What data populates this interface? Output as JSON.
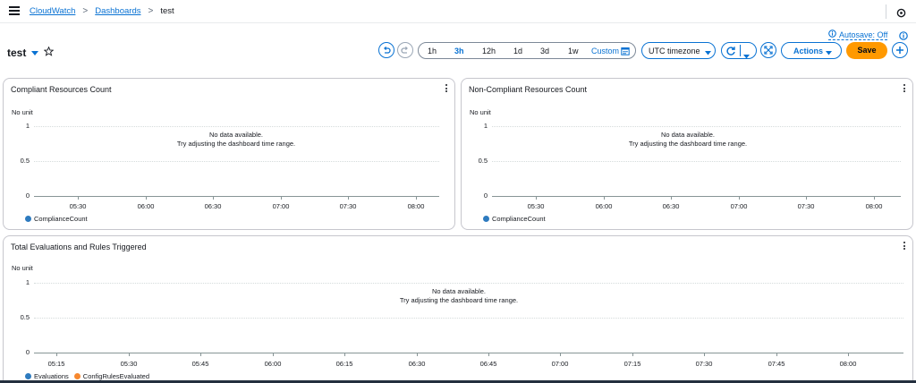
{
  "breadcrumb": {
    "items": [
      "CloudWatch",
      "Dashboards"
    ],
    "current": "test"
  },
  "dashboard": {
    "title": "test"
  },
  "autosave": {
    "label": "Autosave: Off"
  },
  "timerange": {
    "options": [
      "1h",
      "3h",
      "12h",
      "1d",
      "3d",
      "1w"
    ],
    "active": "3h",
    "custom_label": "Custom"
  },
  "timezone": {
    "label": "UTC timezone"
  },
  "toolbar": {
    "actions_label": "Actions",
    "save_label": "Save"
  },
  "colors": {
    "accent": "#0972d3",
    "save": "#ff9900",
    "series_blue": "#2e7bbf",
    "series_orange": "#f7882f"
  },
  "widgets": [
    {
      "title": "Compliant Resources Count",
      "unit": "No unit",
      "nodata_line1": "No data available.",
      "nodata_line2": "Try adjusting the dashboard time range.",
      "legend": [
        {
          "label": "ComplianceCount",
          "color": "#2e7bbf"
        }
      ]
    },
    {
      "title": "Non-Compliant Resources Count",
      "unit": "No unit",
      "nodata_line1": "No data available.",
      "nodata_line2": "Try adjusting the dashboard time range.",
      "legend": [
        {
          "label": "ComplianceCount",
          "color": "#2e7bbf"
        }
      ]
    },
    {
      "title": "Total Evaluations and Rules Triggered",
      "unit": "No unit",
      "nodata_line1": "No data available.",
      "nodata_line2": "Try adjusting the dashboard time range.",
      "legend": [
        {
          "label": "Evaluations",
          "color": "#2e7bbf"
        },
        {
          "label": "ConfigRulesEvaluated",
          "color": "#f7882f"
        }
      ]
    }
  ],
  "chart_data": [
    {
      "type": "line",
      "title": "Compliant Resources Count",
      "ylabel": "No unit",
      "yticks": [
        "1",
        "0.5",
        "0"
      ],
      "ylim": [
        0,
        1
      ],
      "categories": [
        "05:30",
        "06:00",
        "06:30",
        "07:00",
        "07:30",
        "08:00"
      ],
      "series": [
        {
          "name": "ComplianceCount",
          "values": []
        }
      ],
      "grid": true,
      "legend": "bottom-left"
    },
    {
      "type": "line",
      "title": "Non-Compliant Resources Count",
      "ylabel": "No unit",
      "yticks": [
        "1",
        "0.5",
        "0"
      ],
      "ylim": [
        0,
        1
      ],
      "categories": [
        "05:30",
        "06:00",
        "06:30",
        "07:00",
        "07:30",
        "08:00"
      ],
      "series": [
        {
          "name": "ComplianceCount",
          "values": []
        }
      ],
      "grid": true,
      "legend": "bottom-left"
    },
    {
      "type": "line",
      "title": "Total Evaluations and Rules Triggered",
      "ylabel": "No unit",
      "yticks": [
        "1",
        "0.5",
        "0"
      ],
      "ylim": [
        0,
        1
      ],
      "categories": [
        "05:15",
        "05:30",
        "05:45",
        "06:00",
        "06:15",
        "06:30",
        "06:45",
        "07:00",
        "07:15",
        "07:30",
        "07:45",
        "08:00"
      ],
      "series": [
        {
          "name": "Evaluations",
          "values": []
        },
        {
          "name": "ConfigRulesEvaluated",
          "values": []
        }
      ],
      "grid": true,
      "legend": "bottom-left"
    }
  ]
}
